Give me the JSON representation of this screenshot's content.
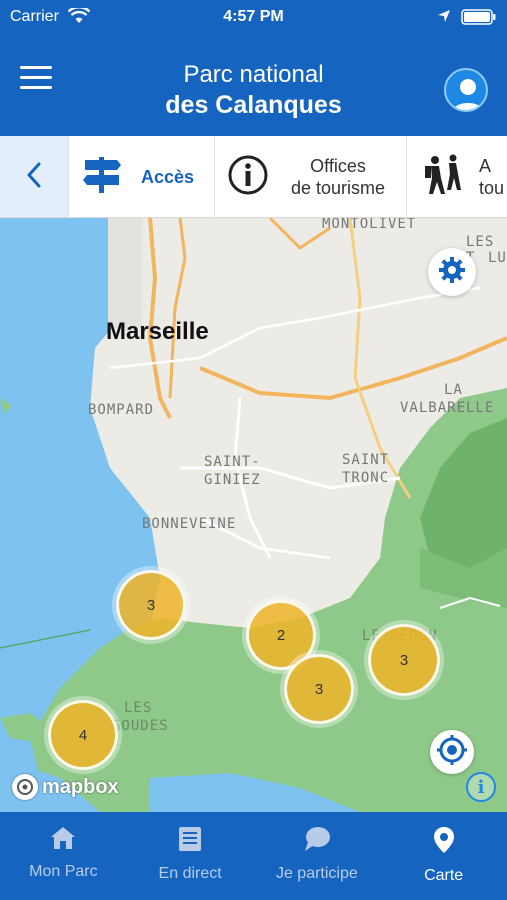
{
  "status_bar": {
    "carrier": "Carrier",
    "time": "4:57 PM"
  },
  "header": {
    "title_line1": "Parc national",
    "title_line2": "des Calanques"
  },
  "categories": [
    {
      "label": "Accès",
      "icon": "signpost-icon"
    },
    {
      "label_line1": "Offices",
      "label_line2": "de tourisme",
      "icon": "info-circle-icon"
    },
    {
      "label_line1": "A",
      "label_line2": "tou",
      "icon": "hikers-icon"
    }
  ],
  "map": {
    "places": {
      "marseille": "Marseille",
      "montolivet": "MONTOLIVET",
      "les_trois_lucs_1": "LES T",
      "les_trois_lucs_2": "LU",
      "bompard": "BOMPARD",
      "la_valbarelle_1": "LA",
      "la_valbarelle_2": "VALBARELLE",
      "saint_giniez_1": "SAINT-",
      "saint_giniez_2": "GINIEZ",
      "saint_tronc_1": "SAINT",
      "saint_tronc_2": "TRONC",
      "bonneveine": "BONNEVEINE",
      "le_redon": "LE REDON",
      "les_goudes_1": "LES",
      "les_goudes_2": "GOUDES"
    },
    "clusters": [
      "3",
      "2",
      "3",
      "3",
      "4"
    ],
    "attribution": "mapbox"
  },
  "tabs": [
    {
      "label": "Mon Parc",
      "icon": "home-icon"
    },
    {
      "label": "En direct",
      "icon": "news-icon"
    },
    {
      "label": "Je participe",
      "icon": "chat-bubble-icon"
    },
    {
      "label": "Carte",
      "icon": "map-pin-icon"
    }
  ],
  "colors": {
    "primary": "#1565c0",
    "water": "#7ec3ef",
    "park_green": "#8fc98a",
    "cluster": "#f0b428"
  }
}
